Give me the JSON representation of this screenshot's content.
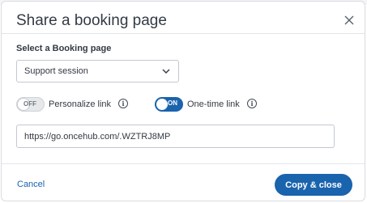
{
  "dialog": {
    "title": "Share a booking page",
    "select_label": "Select a Booking page",
    "selected_page": "Support session",
    "personalize": {
      "state_text": "OFF",
      "label": "Personalize link",
      "on": false
    },
    "one_time": {
      "state_text": "ON",
      "label": "One-time link",
      "on": true
    },
    "link_value": "https://go.oncehub.com/.WZTRJ8MP",
    "cancel_label": "Cancel",
    "primary_label": "Copy & close"
  },
  "colors": {
    "accent": "#1a63ad",
    "text": "#333a44",
    "border": "#c3c8cf"
  },
  "icons": {
    "close": "close-icon",
    "dropdown": "chevron-down-icon",
    "info": "info-icon"
  }
}
